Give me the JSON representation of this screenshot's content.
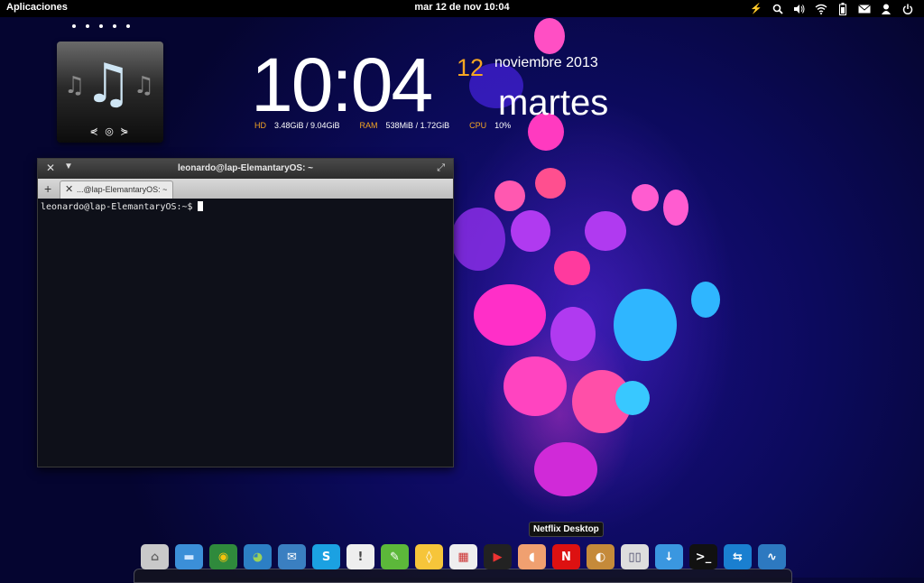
{
  "panel": {
    "apps_label": "Aplicaciones",
    "clock": "mar 12 de nov 10:04",
    "tray_icons": [
      "battery-charge-icon",
      "search-icon",
      "volume-icon",
      "wifi-icon",
      "battery-icon",
      "mail-icon",
      "user-icon",
      "power-icon"
    ]
  },
  "conky": {
    "time": "10:04",
    "day": "12",
    "month_year": "noviembre 2013",
    "weekday": "martes",
    "hd_label": "HD",
    "hd_value": "3.48GiB / 9.04GiB",
    "ram_label": "RAM",
    "ram_value": "538MiB / 1.72GiB",
    "cpu_label": "CPU",
    "cpu_value": "10%"
  },
  "terminal": {
    "title": "leonardo@lap-ElemantaryOS: ~",
    "tab_label": "...@lap-ElemantaryOS: ~",
    "prompt": "leonardo@lap-ElemantaryOS:~$"
  },
  "dock": {
    "tooltip": "Netflix Desktop",
    "items": [
      {
        "name": "files",
        "glyph": "⌂",
        "bg": "#c9c9c9",
        "fg": "#666"
      },
      {
        "name": "desktop",
        "glyph": "▬",
        "bg": "#3b8fd8",
        "fg": "#cfe6ff"
      },
      {
        "name": "chrome",
        "glyph": "◉",
        "bg": "#2f8a3c",
        "fg": "#f4c20d"
      },
      {
        "name": "browser",
        "glyph": "◕",
        "bg": "#2c7fc4",
        "fg": "#9ad25a"
      },
      {
        "name": "mail",
        "glyph": "✉",
        "bg": "#3a7fc1",
        "fg": "#fff"
      },
      {
        "name": "skype",
        "glyph": "S",
        "bg": "#1ba1e2",
        "fg": "#fff"
      },
      {
        "name": "chat",
        "glyph": "!",
        "bg": "#eeeeee",
        "fg": "#444"
      },
      {
        "name": "notes",
        "glyph": "✎",
        "bg": "#5cb83a",
        "fg": "#fff"
      },
      {
        "name": "ideas",
        "glyph": "◊",
        "bg": "#f6c53a",
        "fg": "#fff"
      },
      {
        "name": "calendar",
        "glyph": "▦",
        "bg": "#eeeeee",
        "fg": "#c33"
      },
      {
        "name": "video",
        "glyph": "▶",
        "bg": "#222",
        "fg": "#e33"
      },
      {
        "name": "photos",
        "glyph": "◖",
        "bg": "#f0a070",
        "fg": "#fff"
      },
      {
        "name": "netflix",
        "glyph": "N",
        "bg": "#d11",
        "fg": "#fff"
      },
      {
        "name": "shotwell",
        "glyph": "◐",
        "bg": "#c58a3a",
        "fg": "#fff"
      },
      {
        "name": "tweaks",
        "glyph": "▯▯",
        "bg": "#ddd",
        "fg": "#446"
      },
      {
        "name": "downloads",
        "glyph": "↓",
        "bg": "#3a97e0",
        "fg": "#fff"
      },
      {
        "name": "terminal",
        "glyph": ">_",
        "bg": "#111",
        "fg": "#fff"
      },
      {
        "name": "teamviewer",
        "glyph": "⇆",
        "bg": "#1a7fd0",
        "fg": "#fff"
      },
      {
        "name": "monitor",
        "glyph": "∿",
        "bg": "#2d79c0",
        "fg": "#fff"
      }
    ]
  }
}
